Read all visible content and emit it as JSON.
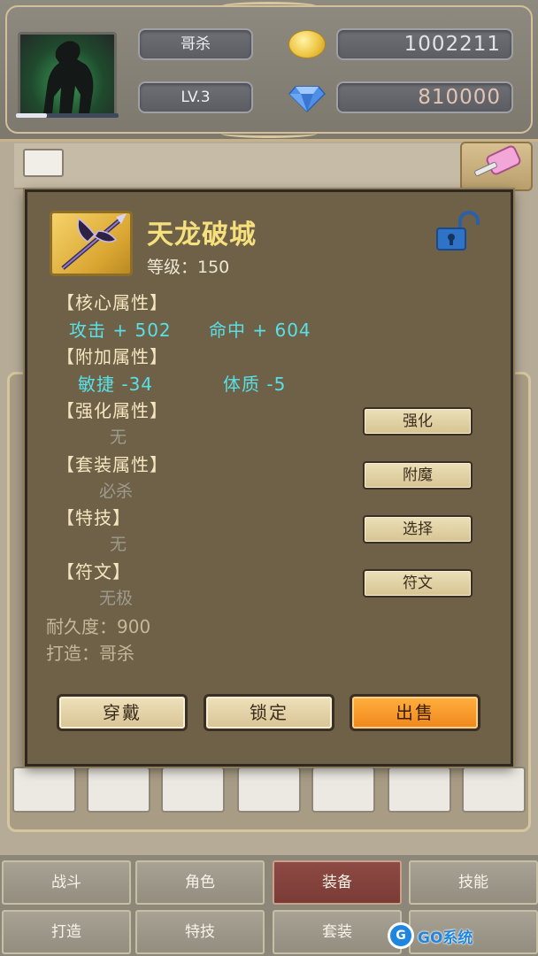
{
  "header": {
    "player_name": "哥杀",
    "level": "LV.3",
    "gold": "1002211",
    "gems": "810000",
    "exp_fraction": 0.3,
    "icons": {
      "gold": "gold-coin-icon",
      "gems": "diamond-icon",
      "portrait": "hero-portrait"
    }
  },
  "dialog": {
    "item_name": "天龙破城",
    "item_level": "等级：150",
    "lock_icon": "unlocked-padlock-icon",
    "sections": {
      "core": "【核心属性】",
      "bonus": "【附加属性】",
      "enhance": "【强化属性】",
      "set": "【套装属性】",
      "skill": "【特技】",
      "rune": "【符文】"
    },
    "core_stats": {
      "attack": "攻击 + 502",
      "hit": "命中 + 604"
    },
    "bonus_stats": {
      "agility": "敏捷  -34",
      "constitution": "体质  -5"
    },
    "enhance_value": "无",
    "set_value": "必杀",
    "skill_value": "无",
    "rune_value": "无极",
    "durability": "耐久度：900",
    "crafted_by": "打造：哥杀",
    "side_buttons": {
      "enhance": "强化",
      "enchant": "附魔",
      "select": "选择",
      "rune": "符文"
    },
    "actions": {
      "equip": "穿戴",
      "lock": "锁定",
      "sell": "出售"
    }
  },
  "nav": {
    "battle": "战斗",
    "character": "角色",
    "equipment": "装备",
    "skills": "技能",
    "craft": "打造",
    "traits": "特技",
    "sets": "套装",
    "active": "equipment"
  },
  "watermark": {
    "logo": "G",
    "text": "GO系统"
  },
  "colors": {
    "stat_cyan": "#58e0e6",
    "title_gold": "#f6e07d",
    "sell_orange": "#f39a2a",
    "dialog_bg": "#6e6147"
  }
}
